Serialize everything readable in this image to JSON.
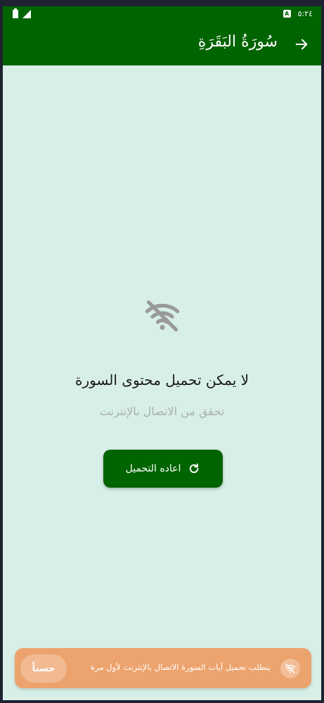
{
  "status_bar": {
    "time": "٥:٢٤",
    "badge": "A"
  },
  "app_bar": {
    "title": "سُورَةُ البَقَرَةِ"
  },
  "error": {
    "title": "لا يمكن تحميل محتوى السورة",
    "subtitle": "تحقق من الاتصال بالإنترنت",
    "retry_label": "اعاده التحميل"
  },
  "snackbar": {
    "message": "يتطلب تحميل آيات السورة الاتصال بالإنترنت لأول مرة",
    "action_label": "حسناً"
  },
  "colors": {
    "primary": "#006400",
    "background": "#d7efe7",
    "snackbar": "#eca36d"
  },
  "icons": [
    "battery-icon",
    "signal-icon",
    "arrow-forward-icon",
    "wifi-off-icon",
    "refresh-icon"
  ]
}
